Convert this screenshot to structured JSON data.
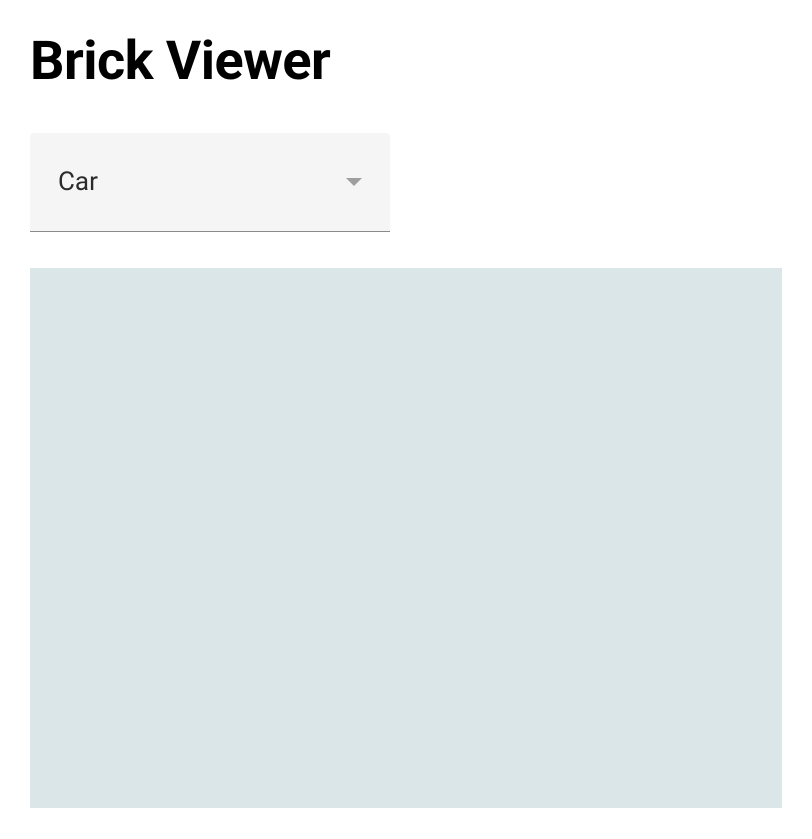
{
  "header": {
    "title": "Brick Viewer"
  },
  "selector": {
    "selected_value": "Car"
  }
}
